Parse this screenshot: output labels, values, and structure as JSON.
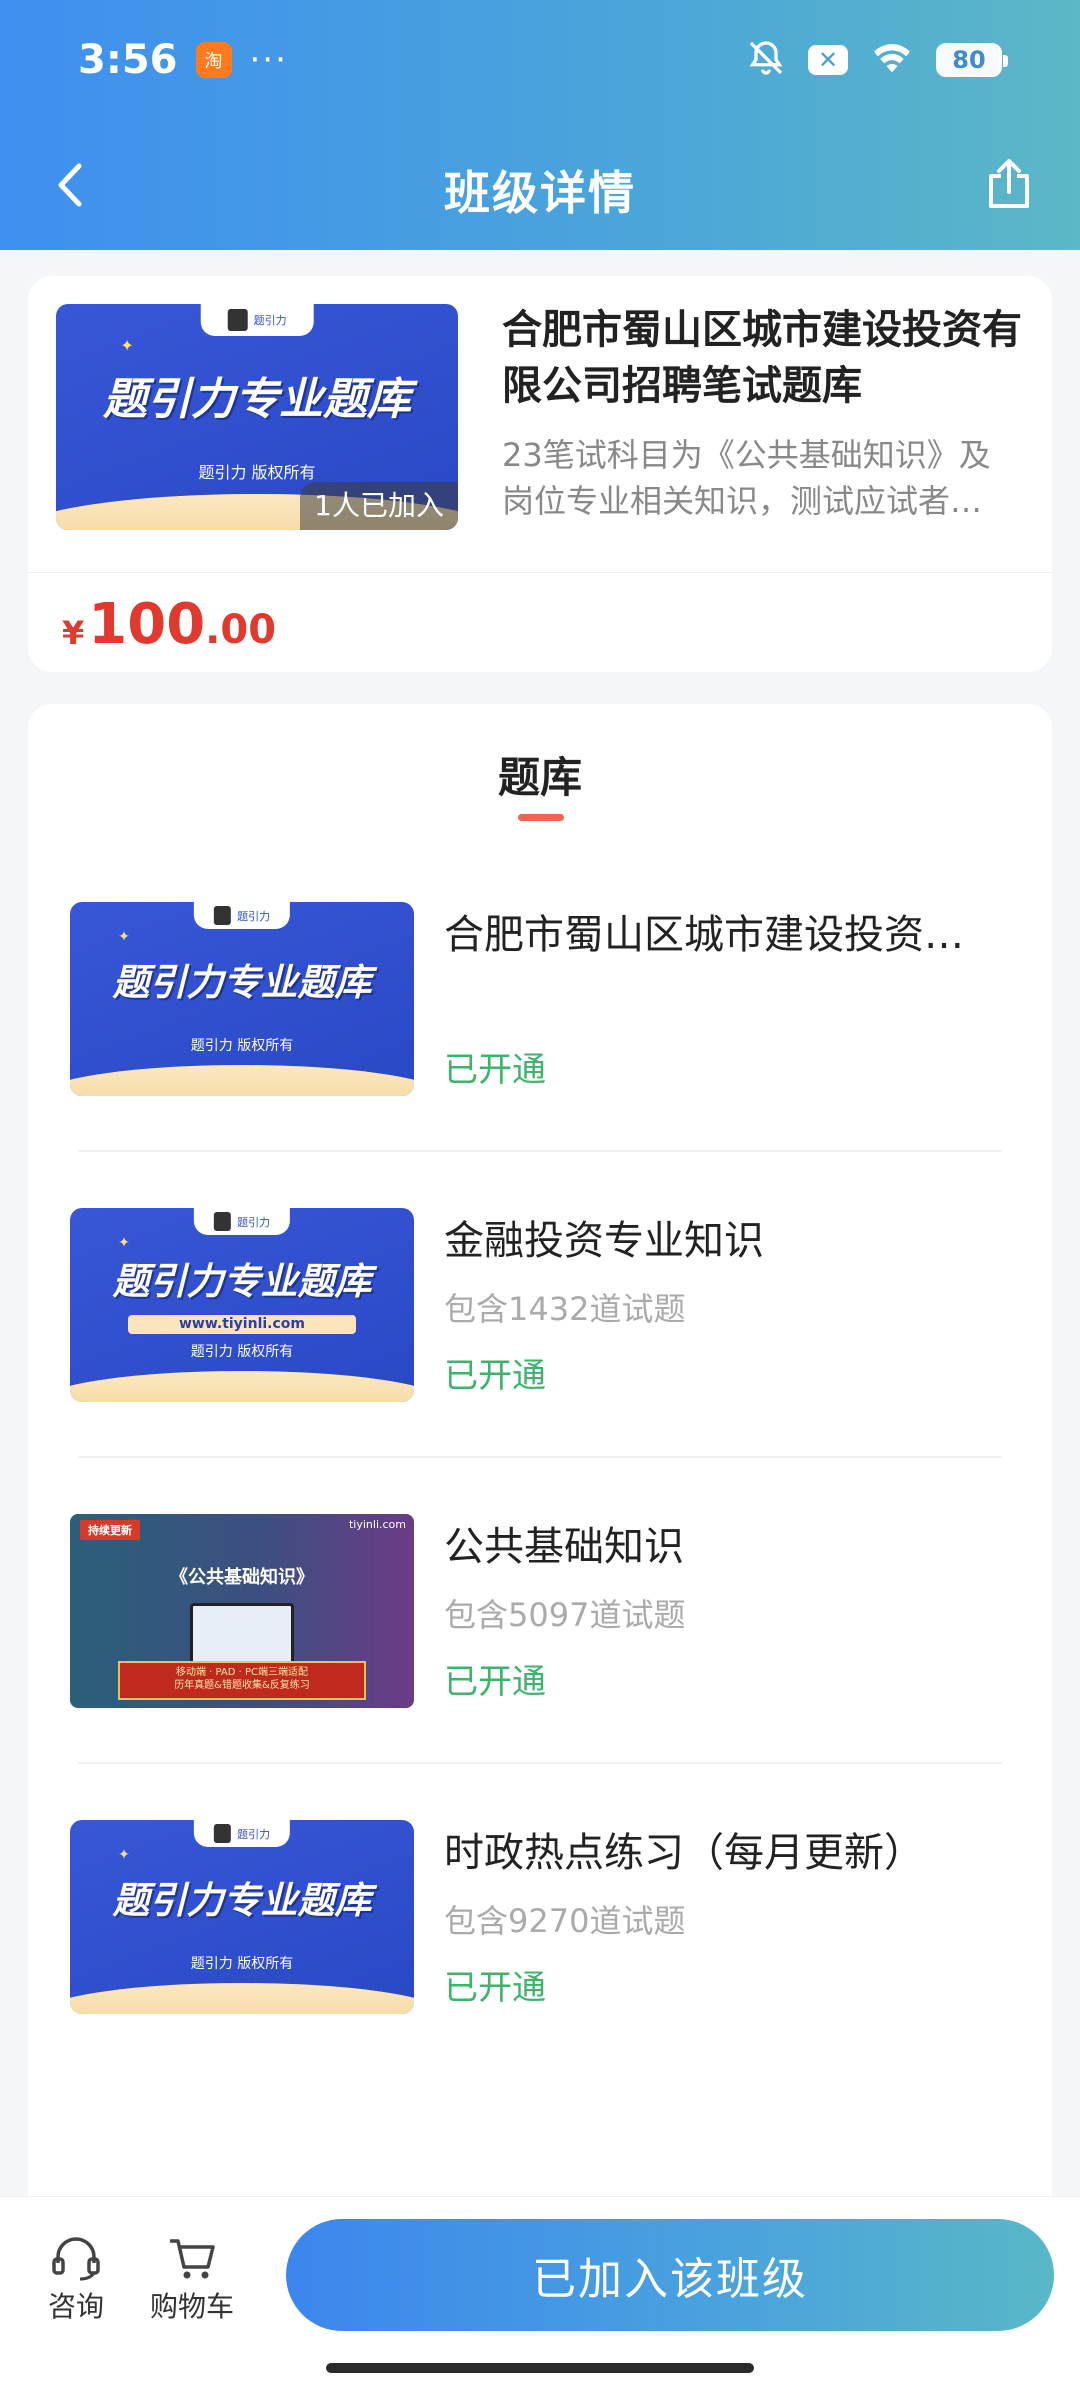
{
  "status_bar": {
    "time": "3:56",
    "app_badge": "淘",
    "dots": "···",
    "x_badge": "✕",
    "battery": "80"
  },
  "nav": {
    "title": "班级详情"
  },
  "class": {
    "title": "合肥市蜀山区城市建设投资有限公司招聘笔试题库",
    "description": "23笔试科目为《公共基础知识》及岗位专业相关知识，测试应试者…",
    "joined": "1人已加入",
    "price": {
      "currency": "¥",
      "integer": "100",
      "decimal": ".00"
    },
    "cover": {
      "banner": "题引力专业题库",
      "copyright": "题引力 版权所有",
      "tab": "题引力"
    }
  },
  "bank": {
    "heading": "题库",
    "items": [
      {
        "name": "合肥市蜀山区城市建设投资…",
        "count": "",
        "status": "已开通"
      },
      {
        "name": "金融投资专业知识",
        "count": "包含1432道试题",
        "status": "已开通"
      },
      {
        "name": "公共基础知识",
        "count": "包含5097道试题",
        "status": "已开通"
      },
      {
        "name": "时政热点练习（每月更新）",
        "count": "包含9270道试题",
        "status": "已开通"
      }
    ],
    "cover_a": {
      "banner": "题引力专业题库",
      "copyright": "题引力 版权所有",
      "tab": "题引力"
    },
    "cover_b": {
      "banner": "题引力专业题库",
      "url": "www.tiyinli.com",
      "copyright": "题引力 版权所有",
      "tab": "题引力"
    },
    "cover_c": {
      "tag": "持续更新",
      "brand": "tiyinli.com",
      "title": "《公共基础知识》",
      "line1": "移动端 · PAD · PC端三端适配",
      "line2": "历年真题&错题收集&反复练习"
    }
  },
  "bottom": {
    "consult": "咨询",
    "cart": "购物车",
    "join": "已加入该班级"
  },
  "colors": {
    "accent": "#3f8ff0",
    "price": "#e03a2e",
    "opened": "#3bb56a",
    "tab_underline": "#e8674e"
  }
}
